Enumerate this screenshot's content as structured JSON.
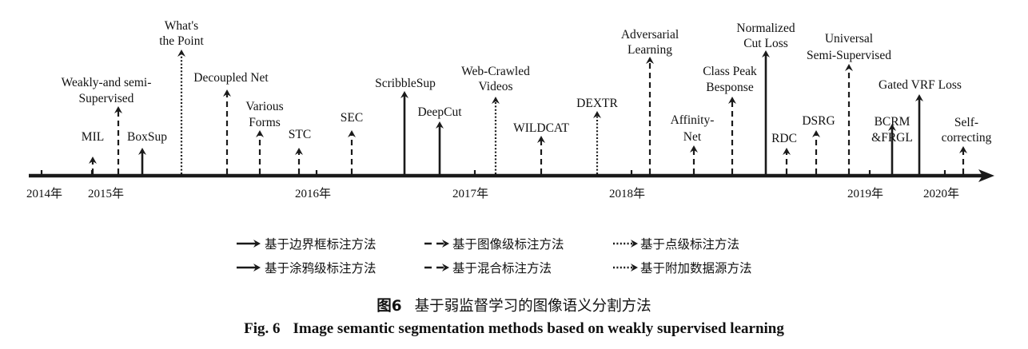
{
  "line_styles": [
    "solid",
    "dashed",
    "dotted"
  ],
  "axis_color": "#1a1a1a",
  "years": [
    "2014年",
    "2015年",
    "2016年",
    "2017年",
    "2018年",
    "2019年",
    "2020年"
  ],
  "methods": [
    {
      "name": "MIL",
      "type": "image"
    },
    {
      "name": "Weakly-and semi-Supervised",
      "type": "mixed"
    },
    {
      "name": "BoxSup",
      "type": "box"
    },
    {
      "name": "What's the Point",
      "type": "point"
    },
    {
      "name": "Decoupled Net",
      "type": "mixed"
    },
    {
      "name": "Various Forms",
      "type": "image"
    },
    {
      "name": "STC",
      "type": "image"
    },
    {
      "name": "SEC",
      "type": "image"
    },
    {
      "name": "ScribbleSup",
      "type": "scribble"
    },
    {
      "name": "DeepCut",
      "type": "box"
    },
    {
      "name": "Web-Crawled Videos",
      "type": "additional"
    },
    {
      "name": "WILDCAT",
      "type": "image"
    },
    {
      "name": "DEXTR",
      "type": "point"
    },
    {
      "name": "Adversarial Learning",
      "type": "mixed"
    },
    {
      "name": "Affinity-Net",
      "type": "image"
    },
    {
      "name": "Class Peak Besponse",
      "type": "image"
    },
    {
      "name": "Normalized Cut Loss",
      "type": "scribble"
    },
    {
      "name": "RDC",
      "type": "image"
    },
    {
      "name": "DSRG",
      "type": "image"
    },
    {
      "name": "Universal Semi-Supervised",
      "type": "mixed"
    },
    {
      "name": "BCRM &FRGL",
      "type": "box"
    },
    {
      "name": "Gated VRF Loss",
      "type": "scribble"
    },
    {
      "name": "Self-correcting",
      "type": "mixed"
    }
  ],
  "legend": [
    {
      "type": "box",
      "label": "基于边界框标注方法"
    },
    {
      "type": "image",
      "label": "基于图像级标注方法"
    },
    {
      "type": "point",
      "label": "基于点级标注方法"
    },
    {
      "type": "scribble",
      "label": "基于涂鸦级标注方法"
    },
    {
      "type": "mixed",
      "label": "基于混合标注方法"
    },
    {
      "type": "additional",
      "label": "基于附加数据源方法"
    }
  ],
  "caption": {
    "number_cn": "图6",
    "title_cn": "基于弱监督学习的图像语义分割方法",
    "number_en": "Fig. 6",
    "title_en": "Image semantic segmentation methods based on weakly supervised learning"
  }
}
